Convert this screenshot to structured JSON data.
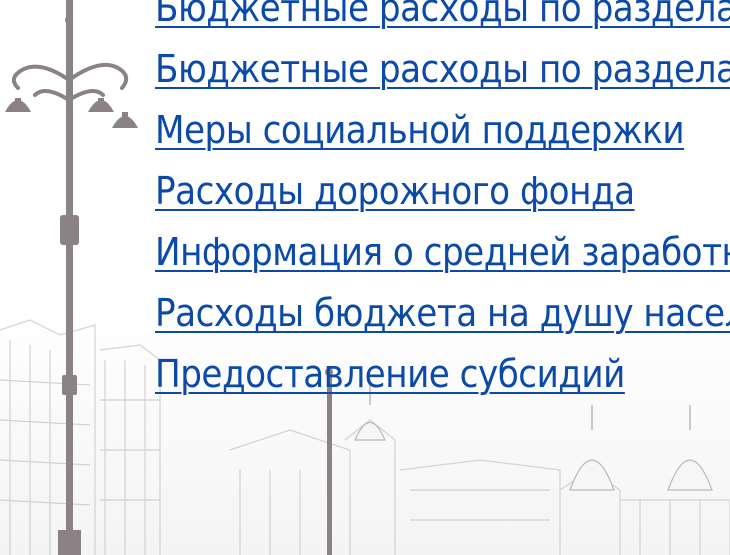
{
  "links": [
    "Бюджетные расходы по разделам",
    "Бюджетные расходы по разделам",
    "Меры социальной поддержки",
    "Расходы дорожного фонда",
    "Информация о средней заработной плате",
    "Расходы бюджета на душу населения",
    "Предоставление субсидий"
  ],
  "colors": {
    "link": "#0b4aa8",
    "art": "#8a8284"
  },
  "icons": {
    "background": "street-lamp-city-sketch"
  }
}
